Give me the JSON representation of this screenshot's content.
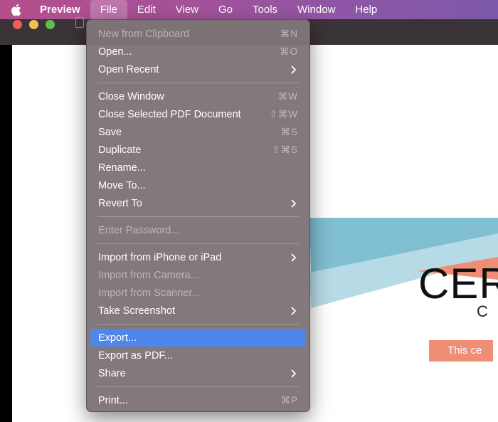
{
  "menubar": {
    "apple_icon": "apple-logo",
    "app_name": "Preview",
    "items": [
      "File",
      "Edit",
      "View",
      "Go",
      "Tools",
      "Window",
      "Help"
    ],
    "active_item": "File"
  },
  "file_menu": {
    "groups": [
      [
        {
          "label": "New from Clipboard",
          "shortcut": "⌘N",
          "enabled": false
        },
        {
          "label": "Open...",
          "shortcut": "⌘O",
          "enabled": true
        },
        {
          "label": "Open Recent",
          "submenu": true,
          "enabled": true
        }
      ],
      [
        {
          "label": "Close Window",
          "shortcut": "⌘W",
          "enabled": true
        },
        {
          "label": "Close Selected PDF Document",
          "shortcut": "⇧⌘W",
          "enabled": true
        },
        {
          "label": "Save",
          "shortcut": "⌘S",
          "enabled": true
        },
        {
          "label": "Duplicate",
          "shortcut": "⇧⌘S",
          "enabled": true
        },
        {
          "label": "Rename...",
          "enabled": true
        },
        {
          "label": "Move To...",
          "enabled": true
        },
        {
          "label": "Revert To",
          "submenu": true,
          "enabled": true
        }
      ],
      [
        {
          "label": "Enter Password...",
          "enabled": false
        }
      ],
      [
        {
          "label": "Import from iPhone or iPad",
          "submenu": true,
          "enabled": true
        },
        {
          "label": "Import from Camera...",
          "enabled": false
        },
        {
          "label": "Import from Scanner...",
          "enabled": false
        },
        {
          "label": "Take Screenshot",
          "submenu": true,
          "enabled": true
        }
      ],
      [
        {
          "label": "Export...",
          "enabled": true,
          "highlighted": true
        },
        {
          "label": "Export as PDF...",
          "enabled": true
        },
        {
          "label": "Share",
          "submenu": true,
          "enabled": true
        }
      ],
      [
        {
          "label": "Print...",
          "shortcut": "⌘P",
          "enabled": true
        }
      ]
    ]
  },
  "document": {
    "title_fragment": "CER",
    "subtitle_fragment": "C",
    "banner_fragment": "This ce"
  },
  "colors": {
    "highlight": "#4e86ec",
    "menu_bg": "#7f7579",
    "cert_blue": "#7fbfd1",
    "cert_light_blue": "#b6dbe6",
    "cert_orange": "#ef8d75"
  }
}
